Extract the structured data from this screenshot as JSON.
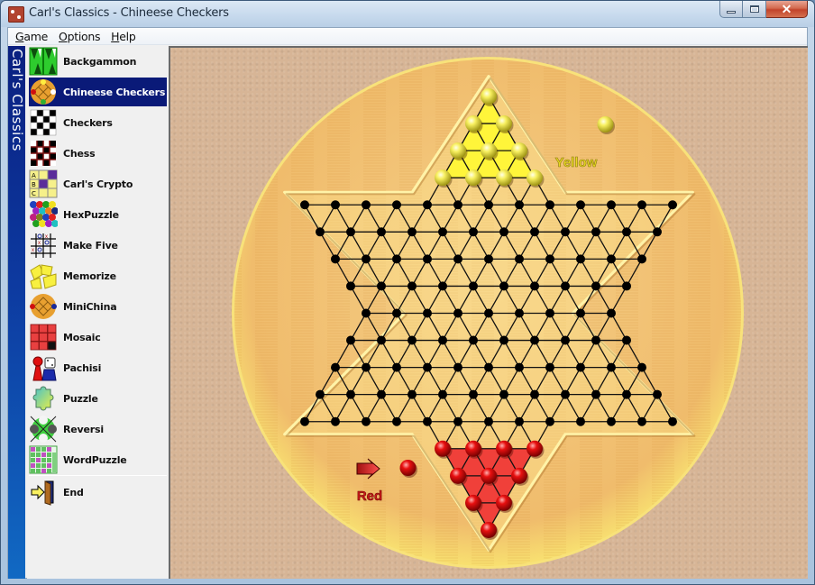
{
  "window": {
    "title": "Carl's Classics - Chineese Checkers",
    "controls": {
      "minimize": "minimize",
      "maximize": "maximize",
      "close": "close"
    }
  },
  "menu": [
    {
      "label": "Game",
      "accel": "G",
      "rest": "ame"
    },
    {
      "label": "Options",
      "accel": "O",
      "rest": "ptions"
    },
    {
      "label": "Help",
      "accel": "H",
      "rest": "elp"
    }
  ],
  "banner": {
    "text": "Carl's Classics"
  },
  "games": [
    {
      "label": "Backgammon",
      "icon": "backgammon-icon",
      "selected": false
    },
    {
      "label": "Chineese Checkers",
      "icon": "chinese-checkers-icon",
      "selected": true
    },
    {
      "label": "Checkers",
      "icon": "checkers-icon",
      "selected": false
    },
    {
      "label": "Chess",
      "icon": "chess-icon",
      "selected": false
    },
    {
      "label": "Carl's Crypto",
      "icon": "crypto-icon",
      "selected": false
    },
    {
      "label": "HexPuzzle",
      "icon": "hexpuzzle-icon",
      "selected": false
    },
    {
      "label": "Make Five",
      "icon": "make-five-icon",
      "selected": false
    },
    {
      "label": "Memorize",
      "icon": "memorize-icon",
      "selected": false
    },
    {
      "label": "MiniChina",
      "icon": "minichina-icon",
      "selected": false
    },
    {
      "label": "Mosaic",
      "icon": "mosaic-icon",
      "selected": false
    },
    {
      "label": "Pachisi",
      "icon": "pachisi-icon",
      "selected": false
    },
    {
      "label": "Puzzle",
      "icon": "puzzle-icon",
      "selected": false
    },
    {
      "label": "Reversi",
      "icon": "reversi-icon",
      "selected": false
    },
    {
      "label": "WordPuzzle",
      "icon": "wordpuzzle-icon",
      "selected": false
    }
  ],
  "end_item": {
    "label": "End",
    "icon": "exit-door-icon"
  },
  "board": {
    "players": [
      {
        "name": "Yellow",
        "color": "#f5f060",
        "camp": "top",
        "pieces": 10,
        "active": false
      },
      {
        "name": "Red",
        "color": "#e01010",
        "camp": "bottom",
        "pieces": 10,
        "active": true
      }
    ],
    "turn_indicator": "Red",
    "row_counts": [
      1,
      2,
      3,
      4,
      13,
      12,
      11,
      10,
      9,
      10,
      11,
      12,
      13,
      4,
      3,
      2,
      1
    ],
    "colors": {
      "wood": "#f2c479",
      "felt": "#d7b596",
      "hole": "#000000",
      "yellow_camp": "#fff53a",
      "red_camp": "#f0403a",
      "yellow_label": "#e8d820",
      "red_label": "#c81818"
    }
  }
}
